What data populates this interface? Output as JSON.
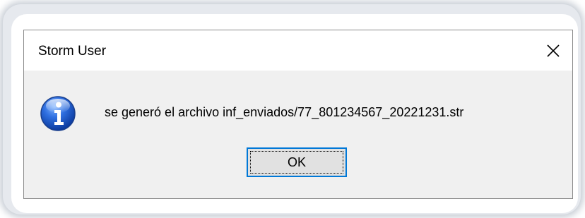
{
  "dialog": {
    "title": "Storm User",
    "message": "se generó el archivo inf_enviados/77_801234567_20221231.str",
    "ok_label": "OK",
    "icon": "info-icon",
    "close_icon": "close-icon"
  }
}
